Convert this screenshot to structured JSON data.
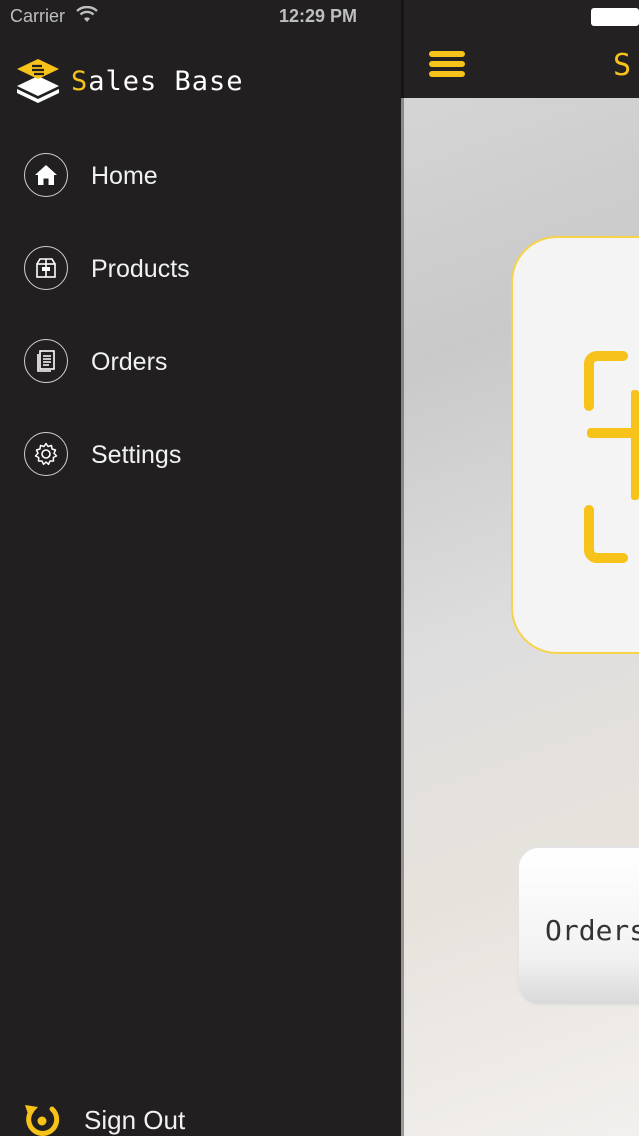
{
  "status_bar": {
    "carrier": "Carrier",
    "time": "12:29 PM"
  },
  "brand": {
    "name_prefix": "S",
    "name_rest": "ales Base",
    "accent_color": "#f7c21a"
  },
  "menu": {
    "items": [
      {
        "label": "Home",
        "icon": "home-icon"
      },
      {
        "label": "Products",
        "icon": "box-icon"
      },
      {
        "label": "Orders",
        "icon": "document-icon"
      },
      {
        "label": "Settings",
        "icon": "gear-icon"
      }
    ],
    "sign_out_label": "Sign Out"
  },
  "content": {
    "nav_title_partial": "S",
    "orders_card_partial": "Orders"
  },
  "colors": {
    "drawer_bg": "#211f20",
    "accent": "#f7c21a"
  }
}
